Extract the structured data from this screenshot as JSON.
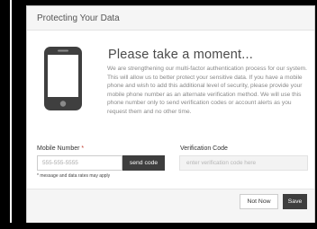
{
  "modal": {
    "title": "Protecting Your Data",
    "heading": "Please take a moment...",
    "body": "We are strengthening our multi-factor authentication process for our system. This will allow us to better protect your sensitive data. If you have a mobile phone and wish to add this additional level of security, please provide your mobile phone number as an alternate verification method. We will use this phone number only to send verification codes or account alerts as you request them and no other time."
  },
  "form": {
    "mobile_label": "Mobile Number",
    "required_marker": "*",
    "mobile_placeholder": "555-555-5555",
    "send_code_label": "send code",
    "code_label": "Verification Code",
    "code_placeholder": "enter verification code here",
    "disclaimer": "* message and data rates may apply"
  },
  "footer": {
    "not_now_label": "Not Now",
    "save_label": "Save"
  },
  "icons": {
    "phone": "mobile-phone-icon"
  },
  "colors": {
    "button_dark": "#3e3e3e",
    "required": "#c0392b"
  }
}
